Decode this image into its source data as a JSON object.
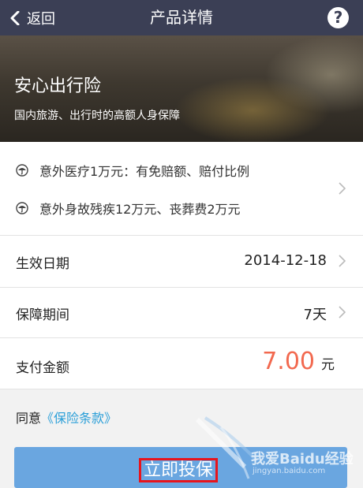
{
  "nav": {
    "back_label": "返回",
    "title": "产品详情",
    "help_label": "?"
  },
  "product": {
    "name": "安心出行险",
    "subtitle": "国内旅游、出行时的高额人身保障"
  },
  "benefits": [
    {
      "text": "意外医疗1万元：有免赔额、赔付比例",
      "icon": "umbrella-icon"
    },
    {
      "text": "意外身故残疾12万元、丧葬费2万元",
      "icon": "umbrella-icon"
    }
  ],
  "rows": {
    "effective_date": {
      "label": "生效日期",
      "value": "2014-12-18"
    },
    "period": {
      "label": "保障期间",
      "value": "7天"
    },
    "payment": {
      "label": "支付金额",
      "amount": "7.00",
      "unit": "元"
    }
  },
  "agree": {
    "prefix": "同意",
    "link_text": "《保险条款》"
  },
  "cta": {
    "label": "立即投保"
  },
  "watermark": {
    "text": "我爱Baidu经验",
    "url": "jingyan.baidu.com"
  },
  "colors": {
    "nav_bg": "#3b3f55",
    "accent_amount": "#f2694f",
    "link": "#2b9fd8",
    "cta_bg": "#6aa6e0",
    "highlight_box": "#e8141c"
  }
}
